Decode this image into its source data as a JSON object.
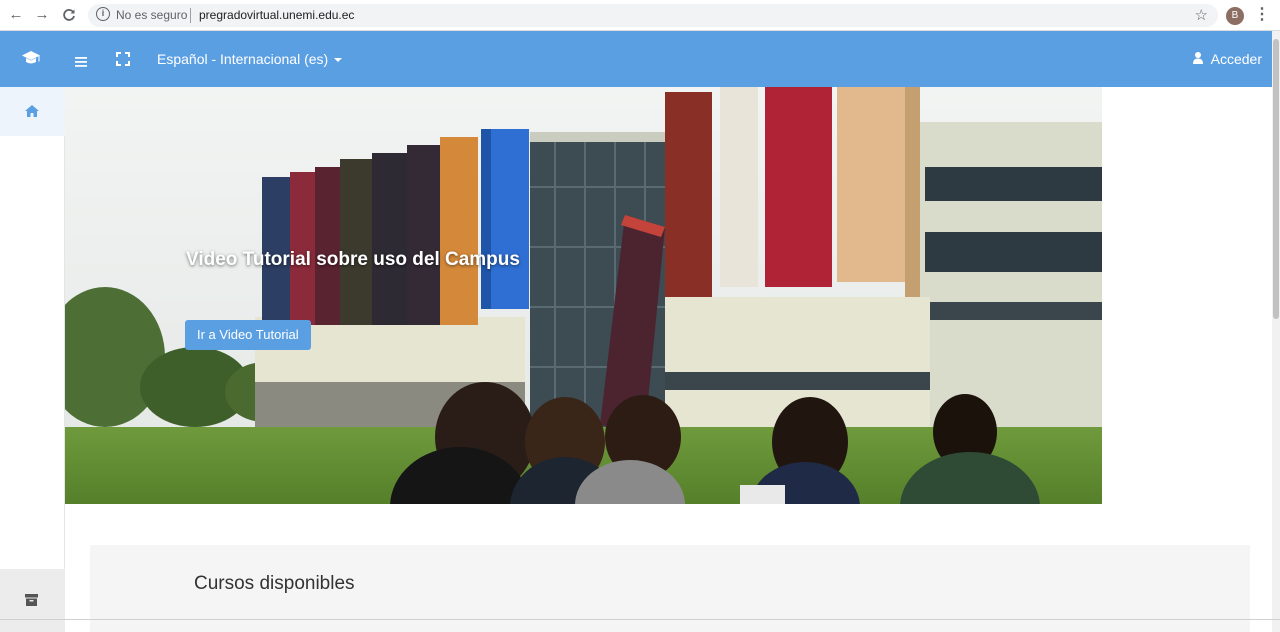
{
  "browser": {
    "security_label": "No es seguro",
    "url": "pregradovirtual.unemi.edu.ec",
    "profile_initial": "B"
  },
  "navbar": {
    "language_label": "Español - Internacional (es)",
    "login_label": "Acceder",
    "color": "#5b9fe3"
  },
  "hero": {
    "title": "Video Tutorial sobre uso del Campus",
    "button_label": "Ir a Video Tutorial"
  },
  "courses": {
    "title": "Cursos disponibles"
  }
}
